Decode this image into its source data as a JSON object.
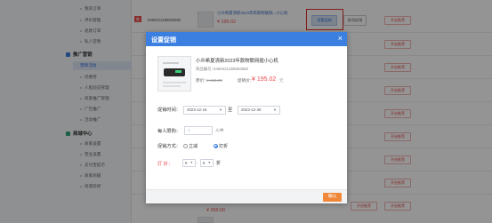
{
  "sidebar": {
    "items": [
      {
        "label": "我的订单"
      },
      {
        "label": "评价管理"
      },
      {
        "label": "退款订单"
      },
      {
        "label": "私人定制"
      },
      {
        "label": "推广营销",
        "group": true
      },
      {
        "label": "营销活动",
        "active": true
      },
      {
        "label": "优惠券"
      },
      {
        "label": "人脸验证管理"
      },
      {
        "label": "商家推广管理"
      },
      {
        "label": "广告推广"
      },
      {
        "label": "活动推广"
      },
      {
        "label": "商城中心",
        "group": true
      },
      {
        "label": "商家设置"
      },
      {
        "label": "营业设置"
      },
      {
        "label": "支付宝提示"
      },
      {
        "label": "商家商铺"
      },
      {
        "label": "商城装修"
      }
    ]
  },
  "background": {
    "tag": "推",
    "code": "6469421286583680",
    "product_title": "小众希夏清新2023年新款物联网...小心机",
    "price": "¥ 195.02",
    "price_bottom": "¥ 399.00",
    "set_promo_label": "设置促销",
    "cancel_promo_label": "取消促销",
    "action_labels": [
      "开启推荐",
      "开启推荐",
      "开启推荐",
      "开启推荐",
      "开启推荐",
      "开启推荐",
      "开启推荐",
      "开启推荐",
      "开启推荐",
      "开启推荐"
    ]
  },
  "modal": {
    "title": "设置促销",
    "close_glyph": "×",
    "product": {
      "name": "小众希夏清新2023年款物联网插小心机",
      "code_label": "商品编号：",
      "code": "6469421286583680",
      "price_label": "原价：",
      "original_price": "¥ 199.00",
      "promo_label": "促销价：",
      "promo_price": "¥ 195.02",
      "promo_unit": "元"
    },
    "time_label": "促销时间：",
    "start_date": "2023-12-15",
    "to_label": "至",
    "end_date": "2023-12-30",
    "limit_label": "每人限购：",
    "limit_placeholder": "1",
    "limit_unit": "人/件",
    "method_label": "促销方式：",
    "method_options": [
      {
        "label": "立减",
        "checked": false
      },
      {
        "label": "打折",
        "checked": true
      }
    ],
    "discount_label": "打    折：",
    "discount_integer": "9",
    "discount_decimal": "8",
    "dot_sep": ".",
    "discount_unit": "折",
    "confirm_label": "确认"
  },
  "colors": {
    "header_blue": "#3b7fe0",
    "price_red": "#e94b4b",
    "confirm_orange": "#f0883a",
    "highlight_red": "#e13131"
  }
}
